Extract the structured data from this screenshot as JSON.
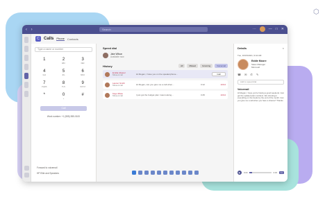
{
  "titlebar": {
    "search_placeholder": "Search"
  },
  "calls": {
    "logo_letter": "C",
    "title": "Calls",
    "tabs": [
      {
        "label": "Phone"
      },
      {
        "label": "Contacts"
      }
    ]
  },
  "dialpad": {
    "input_placeholder": "Type a name or number",
    "keys": [
      {
        "digit": "1",
        "letters": ""
      },
      {
        "digit": "2",
        "letters": "ABC"
      },
      {
        "digit": "3",
        "letters": "DEF"
      },
      {
        "digit": "4",
        "letters": "GHI"
      },
      {
        "digit": "5",
        "letters": "JKL"
      },
      {
        "digit": "6",
        "letters": "MNO"
      },
      {
        "digit": "7",
        "letters": "PQRS"
      },
      {
        "digit": "8",
        "letters": "TUV"
      },
      {
        "digit": "9",
        "letters": "WXYZ"
      },
      {
        "digit": "*",
        "letters": ""
      },
      {
        "digit": "0",
        "letters": "+"
      },
      {
        "digit": "#",
        "letters": ""
      }
    ],
    "call_button": "Call",
    "work_number": "Work number: +1 (555) 555-0100",
    "footer": [
      "Forward to voicemail",
      "HP Elite and Speakers"
    ]
  },
  "center": {
    "speed_dial_title": "Speed dial",
    "speed_dial_contact": {
      "name": "Jake Wilson",
      "subtitle": "Available now"
    },
    "history_title": "History",
    "filters": [
      "All",
      "Missed",
      "Incoming",
      "Voicemail"
    ],
    "active_filter": 3,
    "rows": [
      {
        "name": "Emilia Alvarez",
        "type": "Missed call",
        "message": "Hi Megan, I have you on the speakerphone...",
        "duration": "",
        "action": "Call",
        "time": ""
      },
      {
        "name": "Lauren Smith",
        "type": "Missed call",
        "message": "Hi Megan, can you give me a call when...",
        "duration": "0:12",
        "action": "",
        "time": "10/14"
      },
      {
        "name": "Kayo Miwa",
        "type": "Missed call",
        "message": "I just got the budget plan I was looking...",
        "duration": "0:45",
        "action": "",
        "time": "10/14"
      }
    ]
  },
  "details": {
    "title": "Details",
    "close": "×",
    "meta": "Tue, 10/15/2021, 9:42 AM",
    "contact": {
      "name": "Eddie Moore",
      "title": "Sales Manager",
      "org": "Microsoft"
    },
    "icons": "☎ ✉ ✆ ✎",
    "field_placeholder": "Add to speed dial",
    "summary_title": "Voicemail",
    "summary": "Hi Megan, I hope you're having a good weekend. Just got the updated plan numbers. We should get everything on the books by the end of the month. Can you give me a call when you have a chance? Thanks.",
    "player": {
      "play": "▶",
      "elapsed": "0:00",
      "total": "0:45",
      "speed": "1x",
      "progress": 0.12
    }
  },
  "taskbar_icon_count": 11
}
